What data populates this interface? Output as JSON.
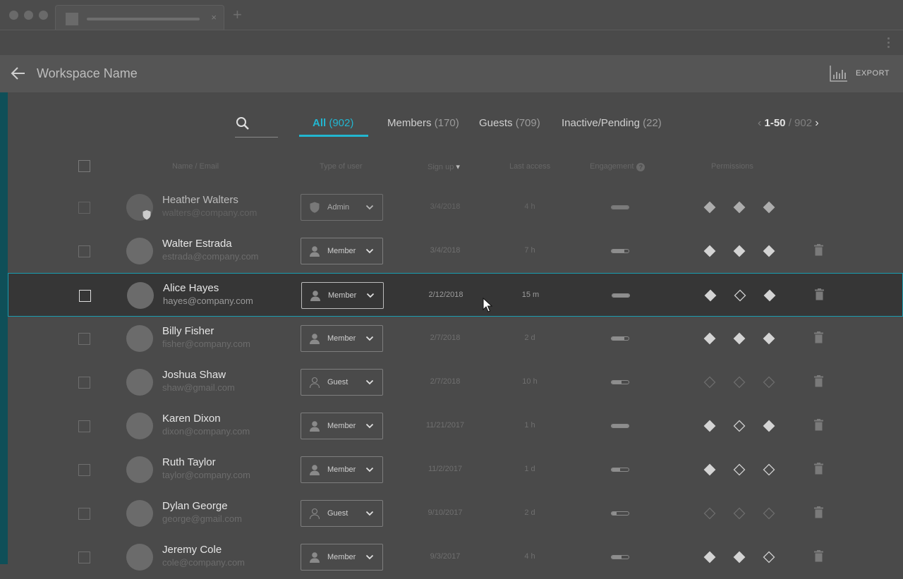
{
  "workspace": {
    "title": "Workspace Name",
    "export_label": "EXPORT"
  },
  "filters": [
    {
      "label": "All",
      "count": "(902)",
      "active": true
    },
    {
      "label": "Members",
      "count": "(170)",
      "active": false
    },
    {
      "label": "Guests",
      "count": "(709)",
      "active": false
    },
    {
      "label": "Inactive/Pending",
      "count": "(22)",
      "active": false
    }
  ],
  "pager": {
    "range": "1-50",
    "separator": "/",
    "total": "902"
  },
  "columns": {
    "name": "Name / Email",
    "type": "Type of user",
    "signup": "Sign up",
    "signup_sort": "▾",
    "last": "Last access",
    "engagement": "Engagement",
    "help": "?",
    "permissions": "Permissions"
  },
  "users": [
    {
      "name": "Heather Walters",
      "email": "walters@company.com",
      "type": "Admin",
      "icon": "shield-icon",
      "signup": "3/4/2018",
      "last": "4 h",
      "engagement": 1.0,
      "perms": [
        "filled",
        "filled",
        "filled"
      ],
      "dim": true,
      "trash": false,
      "badge": true
    },
    {
      "name": "Walter Estrada",
      "email": "estrada@company.com",
      "type": "Member",
      "icon": "person-icon",
      "signup": "3/4/2018",
      "last": "7 h",
      "engagement": 0.75,
      "perms": [
        "filled",
        "filled",
        "filled"
      ],
      "dim": false,
      "trash": true
    },
    {
      "name": "Alice Hayes",
      "email": "hayes@company.com",
      "type": "Member",
      "icon": "person-icon",
      "signup": "2/12/2018",
      "last": "15 m",
      "engagement": 1.0,
      "perms": [
        "filled",
        "empty",
        "filled"
      ],
      "dim": false,
      "trash": true,
      "highlight": true
    },
    {
      "name": "Billy Fisher",
      "email": "fisher@company.com",
      "type": "Member",
      "icon": "person-icon",
      "signup": "2/7/2018",
      "last": "2 d",
      "engagement": 0.75,
      "perms": [
        "filled",
        "filled",
        "filled"
      ],
      "dim": false,
      "trash": true
    },
    {
      "name": "Joshua Shaw",
      "email": "shaw@gmail.com",
      "type": "Guest",
      "icon": "guest-icon",
      "signup": "2/7/2018",
      "last": "10 h",
      "engagement": 0.6,
      "perms": [
        "faint",
        "faint",
        "faint"
      ],
      "dim": false,
      "trash": true
    },
    {
      "name": "Karen Dixon",
      "email": "dixon@company.com",
      "type": "Member",
      "icon": "person-icon",
      "signup": "11/21/2017",
      "last": "1 h",
      "engagement": 1.0,
      "perms": [
        "filled",
        "empty",
        "filled"
      ],
      "dim": false,
      "trash": true
    },
    {
      "name": "Ruth Taylor",
      "email": "taylor@company.com",
      "type": "Member",
      "icon": "person-icon",
      "signup": "11/2/2017",
      "last": "1 d",
      "engagement": 0.5,
      "perms": [
        "filled",
        "empty",
        "empty"
      ],
      "dim": false,
      "trash": true
    },
    {
      "name": "Dylan George",
      "email": "george@gmail.com",
      "type": "Guest",
      "icon": "guest-icon",
      "signup": "9/10/2017",
      "last": "2 d",
      "engagement": 0.3,
      "perms": [
        "faint",
        "faint",
        "faint"
      ],
      "dim": false,
      "trash": true
    },
    {
      "name": "Jeremy Cole",
      "email": "cole@company.com",
      "type": "Member",
      "icon": "person-icon",
      "signup": "9/3/2017",
      "last": "4 h",
      "engagement": 0.6,
      "perms": [
        "filled",
        "filled",
        "empty"
      ],
      "dim": false,
      "trash": true
    }
  ]
}
